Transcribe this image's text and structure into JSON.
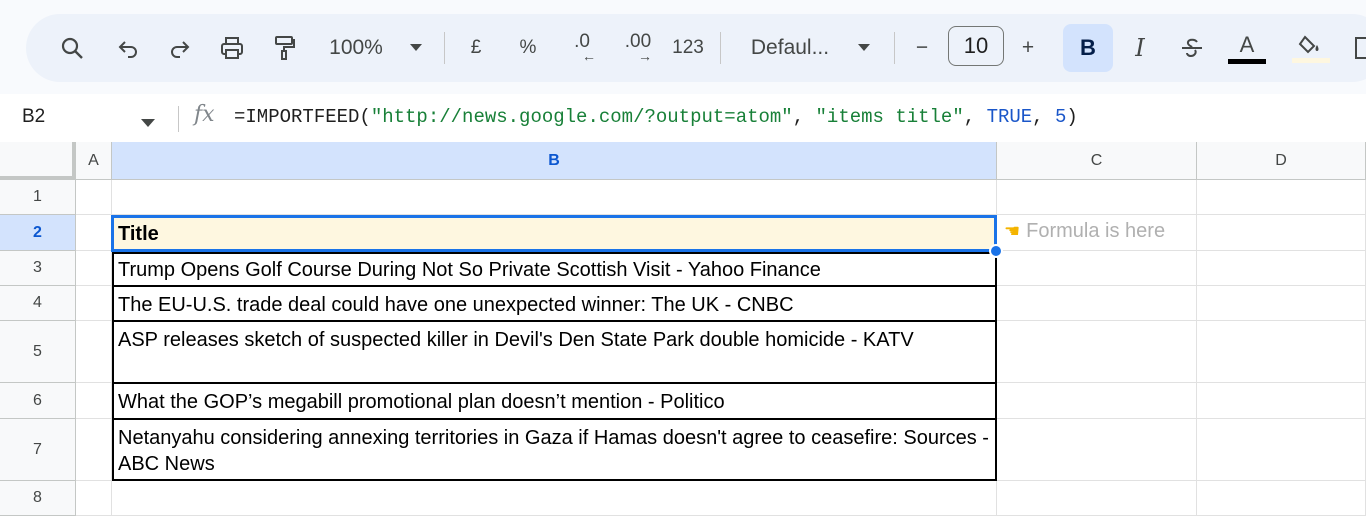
{
  "toolbar": {
    "zoom": "100%",
    "currency": "£",
    "percent": "%",
    "dec_decrease": ".0",
    "dec_increase": ".00",
    "number_format": "123",
    "font": "Defaul...",
    "font_size": "10",
    "minus": "−",
    "plus": "+",
    "bold": "B",
    "italic": "I",
    "text_color_letter": "A"
  },
  "formula_bar": {
    "cell_ref": "B2",
    "fx": "fx",
    "formula_prefix": "=IMPORTFEED(",
    "arg1": "\"http://news.google.com/?output=atom\"",
    "sep1": ", ",
    "arg2": "\"items title\"",
    "sep2": ", ",
    "arg3": "TRUE",
    "sep3": ", ",
    "arg4": "5",
    "formula_suffix": ")"
  },
  "grid": {
    "columns": [
      "A",
      "B",
      "C",
      "D"
    ],
    "rows": [
      "1",
      "2",
      "3",
      "4",
      "5",
      "6",
      "7",
      "8"
    ],
    "selected_column": "B",
    "selected_row": "2",
    "cells": {
      "B2": "Title",
      "B3": "Trump Opens Golf Course During Not So Private Scottish Visit - Yahoo Finance",
      "B4": "The EU-U.S. trade deal could have one unexpected winner: The UK - CNBC",
      "B5": "ASP releases sketch of suspected killer in Devil's Den State Park double homicide - KATV",
      "B6": "What the GOP’s megabill promotional plan doesn’t mention - Politico",
      "B7": "Netanyahu considering annexing territories in Gaza if Hamas doesn't agree to ceasefire: Sources - ABC News"
    },
    "annotation": "Formula is here",
    "annotation_icon": "pointing-hand-icon"
  },
  "colors": {
    "selection": "#1a73e8",
    "header_highlight": "#d3e3fd",
    "title_fill": "#fef7e0"
  }
}
